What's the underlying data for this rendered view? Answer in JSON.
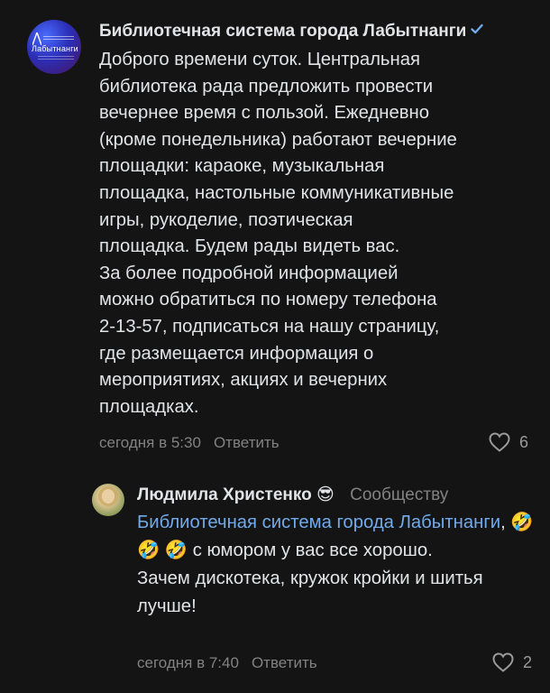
{
  "comment1": {
    "author": "Библиотечная система города  Лабытнанги",
    "avatar_text": "Лабытнанги",
    "verified_icon": "verified-check-icon",
    "text": "Доброго времени суток. Центральная\nбиблиотека рада предложить провести\nвечернее время с пользой. Ежедневно\n(кроме понедельника) работают вечерние\nплощадки: караоке, музыкальная\nплощадка, настольные коммуникативные\nигры, рукоделие, поэтическая\nплощадка. Будем рады видеть вас.\nЗа более подробной информацией\nможно обратиться по номеру телефона\n2-13-57, подписаться на нашу страницу,\nгде размещается информация о\nмероприятиях, акциях и вечерних\nплощадках.",
    "time": "сегодня в 5:30",
    "reply_label": "Ответить",
    "likes": "6"
  },
  "comment2": {
    "author": "Людмила Христенко",
    "author_emoji": "😎",
    "reply_to": "Сообществу",
    "mention": "Библиотечная система города Лабытнанги",
    "mention_suffix": ",",
    "emojis": "🤣 🤣 🤣",
    "text_after_emojis": " с юмором у вас все хорошо.",
    "text2": "Зачем дискотека, кружок кройки и шитья лучше!",
    "time": "сегодня в 7:40",
    "reply_label": "Ответить",
    "likes": "2"
  },
  "colors": {
    "background": "#141414",
    "text": "#e1e3e6",
    "secondary": "#828282",
    "link": "#71aaeb"
  }
}
